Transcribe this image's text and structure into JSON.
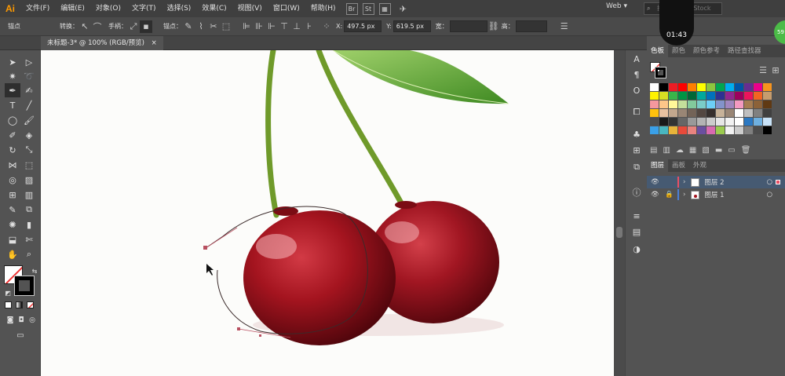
{
  "menubar": {
    "logo": "Ai",
    "items": [
      "文件(F)",
      "编辑(E)",
      "对象(O)",
      "文字(T)",
      "选择(S)",
      "效果(C)",
      "视图(V)",
      "窗口(W)",
      "帮助(H)"
    ],
    "br": "Br",
    "st": "St",
    "workspace": "Web",
    "search_placeholder": "搜索 Adobe Stock"
  },
  "control": {
    "anchor_label": "锚点",
    "convert_label": "转换：",
    "handle_label": "手柄：",
    "anchor2_label": "锚点：",
    "x_label": "X:",
    "x_value": "497.5 px",
    "y_label": "Y:",
    "y_value": "619.5 px",
    "w_label": "宽：",
    "h_label": "高："
  },
  "document_tab": {
    "title": "未标题-3* @ 100% (RGB/预览)",
    "close": "×"
  },
  "recording": {
    "time": "01:43"
  },
  "swatches": {
    "tabs": [
      "色板",
      "颜色",
      "颜色参考",
      "路径查找器"
    ],
    "colors": [
      "#ffffff",
      "#000000",
      "#ed1c24",
      "#ff0000",
      "#ff7f00",
      "#ffff00",
      "#8cc63f",
      "#00a651",
      "#00aeef",
      "#0054a6",
      "#662d91",
      "#ec008c",
      "#f7941d",
      "#fff200",
      "#d7df23",
      "#39b54a",
      "#009444",
      "#006838",
      "#00a99d",
      "#0072bc",
      "#2e3192",
      "#92278f",
      "#9e005d",
      "#ed145b",
      "#f26522",
      "#c69c6d",
      "#f5989d",
      "#fdc689",
      "#fff799",
      "#c4df9b",
      "#82ca9c",
      "#7accc8",
      "#6dcff6",
      "#8393ca",
      "#a186be",
      "#f49ac1",
      "#a67c52",
      "#8c6239",
      "#603913",
      "#ffc20e",
      "#e8c1a0",
      "#c2a78d",
      "#998675",
      "#736357",
      "#534741",
      "#362f2d",
      "#c7b299",
      "#998675",
      "#ffffff",
      "#c0c0c0",
      "#808080",
      "#404040",
      "#4d4d4d",
      "#1a1a1a",
      "#333333",
      "#666666",
      "#999999",
      "#b3b3b3",
      "#cccccc",
      "#e6e6e6",
      "#f2f2f2",
      "#ffffff",
      "#2b78c2",
      "#6fb0e0",
      "#c8e2f7",
      "#3aa0e8",
      "#49b7c0",
      "#e8b33a",
      "#e84a3a",
      "#e8837f",
      "#6b4fa0",
      "#d86ab0",
      "#9bcb4f",
      "#f2f2f2",
      "#cccccc",
      "#7f7f7f",
      "#4c4c4c",
      "#000000"
    ]
  },
  "layers": {
    "tabs": [
      "图层",
      "画板",
      "外观"
    ],
    "items": [
      {
        "name": "图层 2",
        "color": "#e94f64"
      },
      {
        "name": "图层 1",
        "color": "#4a7fd6"
      }
    ]
  },
  "colors": {
    "cherry": "#a4141f",
    "cherry_dark": "#5e070d",
    "stem": "#6f9a2a",
    "leaf": "#6cae3b",
    "path": "#b85060"
  }
}
